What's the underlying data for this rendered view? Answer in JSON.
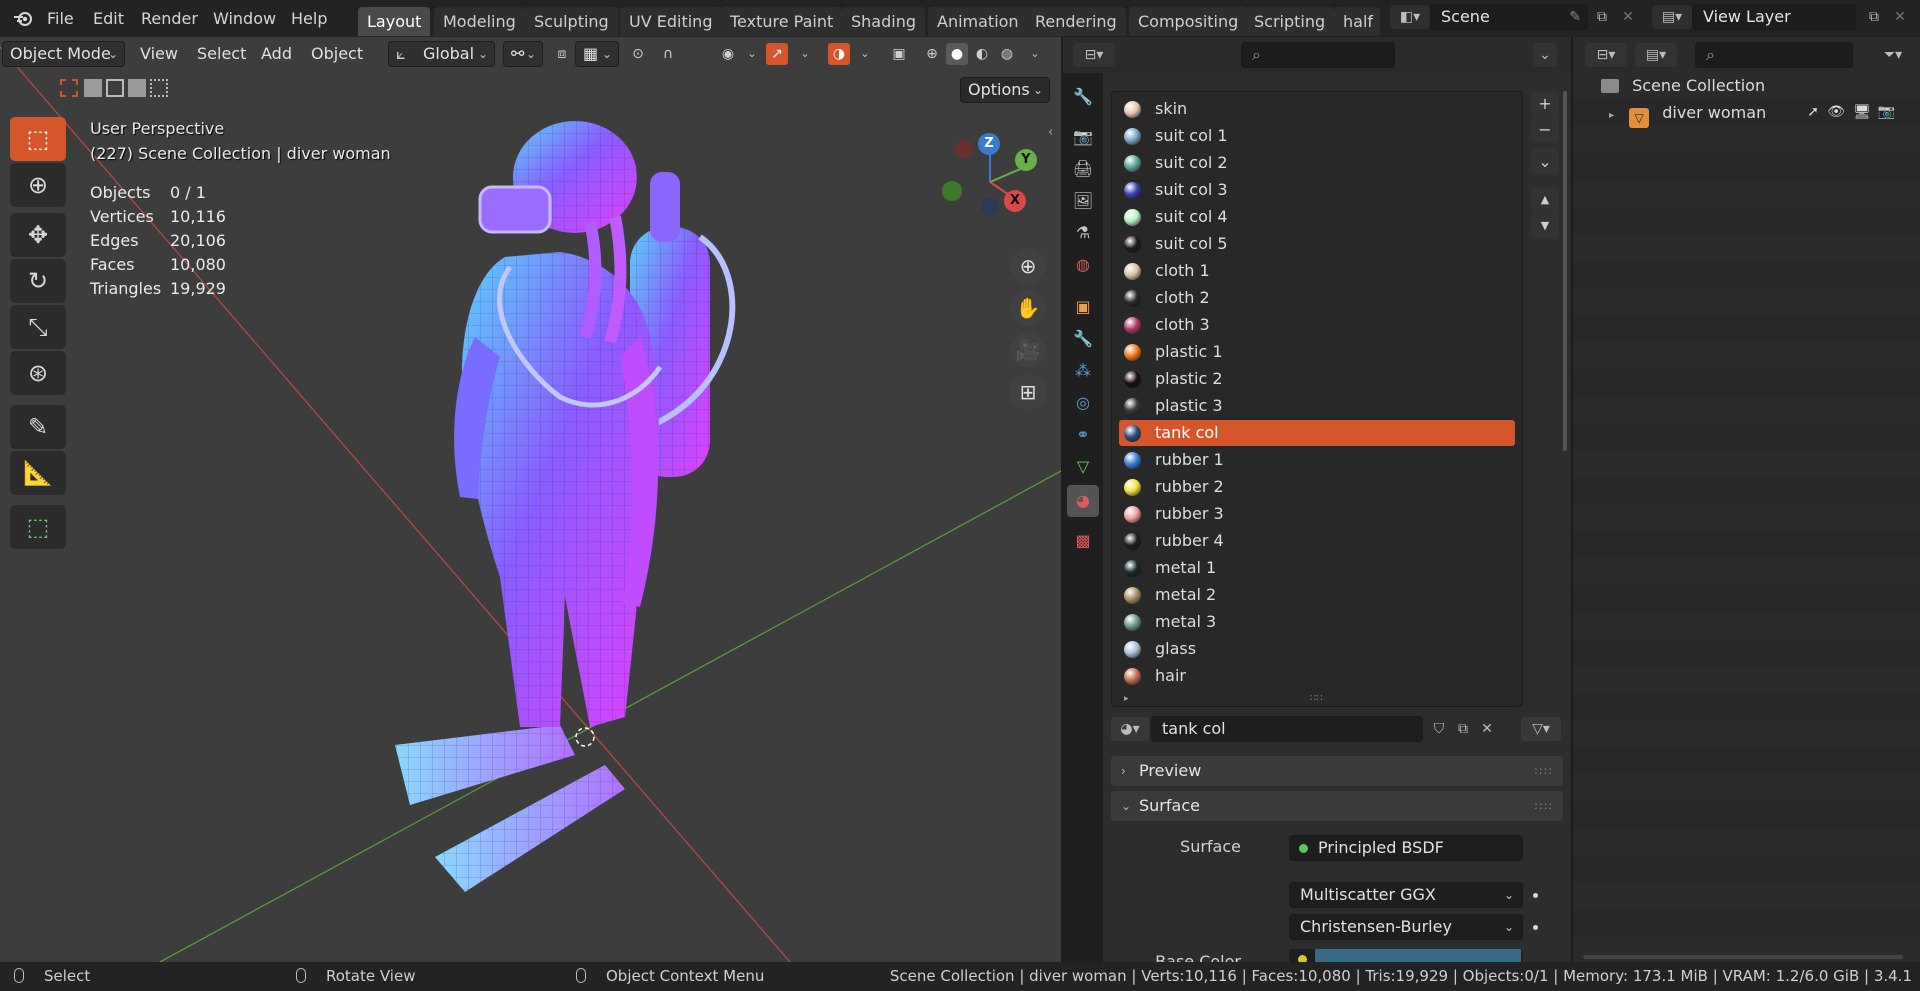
{
  "topbar": {
    "menus": [
      "File",
      "Edit",
      "Render",
      "Window",
      "Help"
    ],
    "workspaces": [
      "Layout",
      "Modeling",
      "Sculpting",
      "UV Editing",
      "Texture Paint",
      "Shading",
      "Animation",
      "Rendering",
      "Compositing",
      "Scripting",
      "half"
    ],
    "active_workspace": "Layout",
    "scene_name": "Scene",
    "view_layer": "View Layer"
  },
  "viewport": {
    "mode": "Object Mode",
    "menus": [
      "View",
      "Select",
      "Add",
      "Object"
    ],
    "transform_orientation": "Global",
    "options_label": "Options",
    "perspective": "User Perspective",
    "collection_info": "(227) Scene Collection | diver woman",
    "stats": [
      {
        "label": "Objects",
        "value": "0 / 1"
      },
      {
        "label": "Vertices",
        "value": "10,116"
      },
      {
        "label": "Edges",
        "value": "20,106"
      },
      {
        "label": "Faces",
        "value": "10,080"
      },
      {
        "label": "Triangles",
        "value": "19,929"
      }
    ],
    "gizmo": {
      "z": "Z",
      "y": "Y",
      "x": "X"
    }
  },
  "materials": {
    "slots": [
      {
        "name": "skin",
        "color": "#e8c4b0"
      },
      {
        "name": "suit col 1",
        "color": "#7aa6c8"
      },
      {
        "name": "suit col 2",
        "color": "#5aa69a"
      },
      {
        "name": "suit col 3",
        "color": "#3a44b0"
      },
      {
        "name": "suit col 4",
        "color": "#b8f0c0"
      },
      {
        "name": "suit col 5",
        "color": "#1c1c1c"
      },
      {
        "name": "cloth 1",
        "color": "#d8c0a8"
      },
      {
        "name": "cloth 2",
        "color": "#2a2a2a"
      },
      {
        "name": "cloth 3",
        "color": "#b03a6a"
      },
      {
        "name": "plastic 1",
        "color": "#f07a20"
      },
      {
        "name": "plastic 2",
        "color": "#1a0f0f"
      },
      {
        "name": "plastic 3",
        "color": "#3a3a3a"
      },
      {
        "name": "tank col",
        "color": "#2a4a7a"
      },
      {
        "name": "rubber 1",
        "color": "#3a80d8"
      },
      {
        "name": "rubber 2",
        "color": "#f0e040"
      },
      {
        "name": "rubber 3",
        "color": "#f0a0a0"
      },
      {
        "name": "rubber 4",
        "color": "#1e1e1e"
      },
      {
        "name": "metal 1",
        "color": "#1a2a2a"
      },
      {
        "name": "metal 2",
        "color": "#a89060"
      },
      {
        "name": "metal 3",
        "color": "#6a9a8a"
      },
      {
        "name": "glass",
        "color": "#a8c0d8"
      },
      {
        "name": "hair",
        "color": "#c07050"
      }
    ],
    "active_slot": "tank col",
    "active_name": "tank col",
    "panels": {
      "preview": "Preview",
      "surface": "Surface"
    },
    "surface_label": "Surface",
    "surface_shader": "Principled BSDF",
    "distribution": "Multiscatter GGX",
    "subsurface_method": "Christensen-Burley",
    "base_color_label": "Base Color",
    "base_color": "#3a6a8a"
  },
  "outliner": {
    "root": "Scene Collection",
    "object": "diver woman"
  },
  "statusbar": {
    "left_action": "Select",
    "middle_action": "Rotate View",
    "right_action": "Object Context Menu",
    "info": "Scene Collection | diver woman | Verts:10,116 | Faces:10,080 | Tris:19,929 | Objects:0/1 | Memory: 173.1 MiB | VRAM: 1.2/6.0 GiB | 3.4.1"
  },
  "colors": {
    "accent": "#d4562a",
    "mesh_normal_a": "#a040ff",
    "mesh_normal_b": "#40c0ff",
    "axis_x": "#d84a4a",
    "axis_y": "#6ab04a"
  }
}
